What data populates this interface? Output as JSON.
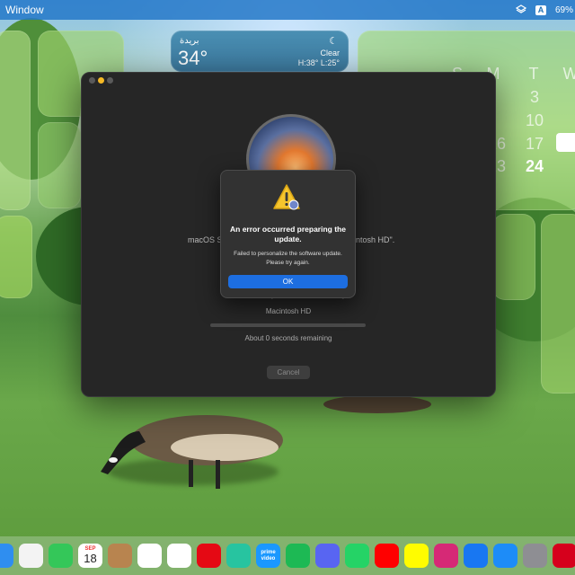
{
  "menubar": {
    "app_name": "Window",
    "battery": "69%",
    "input_source": "A"
  },
  "weather": {
    "city": "بريدة",
    "temperature": "34°",
    "condition": "Clear",
    "high_low": "H:38° L:25°"
  },
  "calendar": {
    "weekday_headers": [
      "S",
      "M",
      "T",
      "W"
    ],
    "rows": [
      [
        "",
        "3",
        "",
        ""
      ],
      [
        "",
        "10",
        "",
        ""
      ],
      [
        "",
        "16",
        "17",
        "18"
      ],
      [
        "",
        "23",
        "24",
        ""
      ]
    ],
    "today": "18"
  },
  "installer": {
    "message_left": "macOS Se",
    "message_right": "ntosh HD\".",
    "disk_name": "Macintosh HD",
    "progress_fraction": 0,
    "time_remaining": "About 0 seconds remaining",
    "cancel_label": "Cancel"
  },
  "alert": {
    "title": "An error occurred preparing the update.",
    "message": "Failed to personalize the software update. Please try again.",
    "ok_label": "OK"
  },
  "dock": {
    "items": [
      {
        "name": "mail",
        "color": "#2f8ef0"
      },
      {
        "name": "photos",
        "color": "#f3f3f3"
      },
      {
        "name": "facetime",
        "color": "#34c759"
      },
      {
        "name": "calendar",
        "color": "#ffffff",
        "month": "SEP",
        "day": "18"
      },
      {
        "name": "contacts",
        "color": "#b8844f"
      },
      {
        "name": "reminders",
        "color": "#ffffff"
      },
      {
        "name": "notion",
        "color": "#ffffff"
      },
      {
        "name": "netflix",
        "color": "#e50914"
      },
      {
        "name": "messages-alt",
        "color": "#27c4a0"
      },
      {
        "name": "prime-video",
        "color": "#1a98ff"
      },
      {
        "name": "spotify",
        "color": "#1db954"
      },
      {
        "name": "discord",
        "color": "#5865f2"
      },
      {
        "name": "whatsapp",
        "color": "#25d366"
      },
      {
        "name": "youtube",
        "color": "#ff0000"
      },
      {
        "name": "snapchat",
        "color": "#fffc00"
      },
      {
        "name": "instagram",
        "color": "#d62976"
      },
      {
        "name": "facebook",
        "color": "#1877f2"
      },
      {
        "name": "app-store",
        "color": "#1d8cf8"
      },
      {
        "name": "system-settings",
        "color": "#8e8e93"
      },
      {
        "name": "acrobat",
        "color": "#d6001c"
      }
    ],
    "labels": {
      "prime_video": "prime video"
    }
  }
}
